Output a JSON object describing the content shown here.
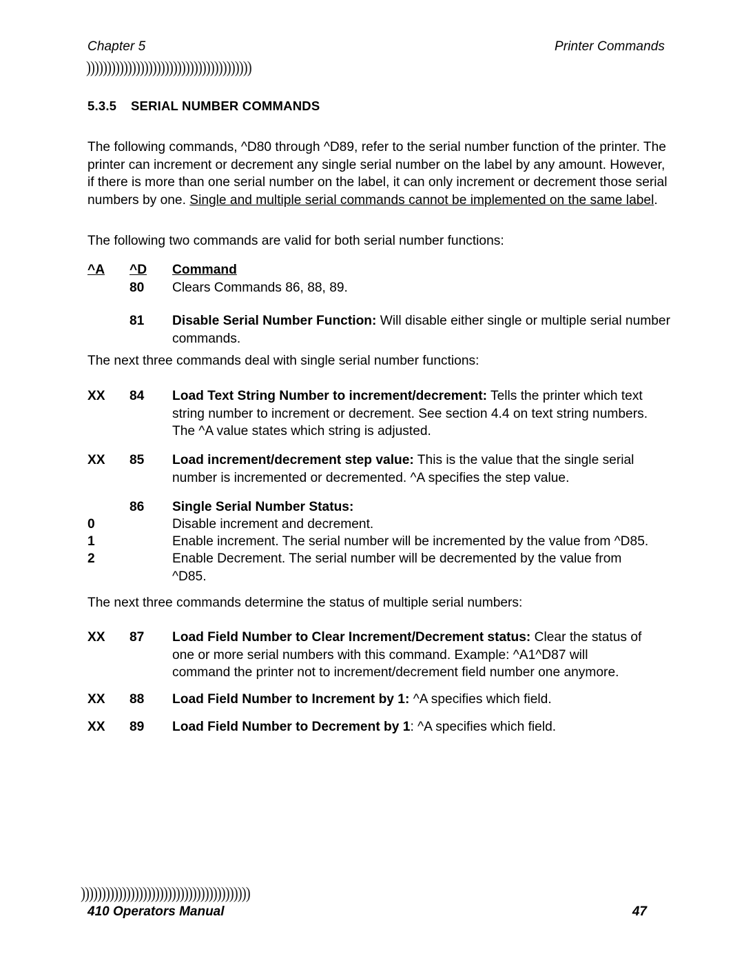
{
  "header": {
    "chapter": "Chapter 5",
    "section_name": "Printer Commands",
    "rule_glyphs": "))))))))))))))))))))))))))))))))))))))))"
  },
  "footer": {
    "manual_title": "410 Operators Manual",
    "page_number": "47",
    "rule_glyphs": ")))))))))))))))))))))))))))))))))))))))))"
  },
  "section": {
    "number": "5.3.5",
    "title": "SERIAL NUMBER COMMANDS"
  },
  "intro": {
    "plain_part": "The following commands, ^D80 through ^D89, refer to the serial number function of the printer. The printer can increment or decrement any single serial number on the label by any amount. However, if there is more than one serial number on the label, it can only increment or decrement those serial numbers by one. ",
    "underlined_part": "Single and multiple serial commands cannot be implemented on the same label",
    "tail": "."
  },
  "lead_in_both": "The following two commands are valid for both serial number functions:",
  "lead_in_single": "The next three commands deal with single serial number functions:",
  "lead_in_multiple": "The next three commands determine the status of multiple serial numbers:",
  "table_header": {
    "col_a": "^A",
    "col_d": "^D",
    "col_command": "Command"
  },
  "commands": {
    "c80": {
      "col_a": "",
      "col_d": "80",
      "bold_lead": "",
      "text": "Clears Commands 86, 88, 89."
    },
    "c81": {
      "col_a": "",
      "col_d": "81",
      "bold_lead": "Disable Serial Number Function:",
      "text": " Will disable either single or multiple serial number commands."
    },
    "c84": {
      "col_a": "XX",
      "col_d": "84",
      "bold_lead": "Load Text String Number to increment/decrement:",
      "text": " Tells the printer which text string number to increment or decrement. See section 4.4 on text string numbers.  The ^A value states which string is adjusted."
    },
    "c85": {
      "col_a": "XX",
      "col_d": "85",
      "bold_lead": "Load increment/decrement step value:",
      "text": " This is the value that the single serial number is incremented or decremented. ^A specifies the step value."
    },
    "c86": {
      "col_a": "",
      "col_d": "86",
      "bold_lead": "Single Serial Number Status:",
      "text": ""
    },
    "c86_options": [
      {
        "value": "0",
        "text": "Disable increment and decrement."
      },
      {
        "value": "1",
        "text": "Enable increment. The serial number will be incremented by the value from ^D85."
      },
      {
        "value": "2",
        "text": "Enable Decrement. The serial number will be decremented by the value from ^D85."
      }
    ],
    "c87": {
      "col_a": "XX",
      "col_d": "87",
      "bold_lead": "Load Field Number to Clear Increment/Decrement status:",
      "line1_tail": " Clear the status of",
      "line2": "one or more serial numbers with this command. Example: ^A1^D87 will",
      "line3": "command the printer not to increment/decrement field number one anymore."
    },
    "c88": {
      "col_a": "XX",
      "col_d": "88",
      "bold_lead": "Load Field Number to Increment by 1:",
      "text": " ^A specifies which field."
    },
    "c89": {
      "col_a": "XX",
      "col_d": "89",
      "bold_lead": "Load Field Number to Decrement by 1",
      "colon": ":",
      "text": " ^A specifies which field."
    }
  }
}
